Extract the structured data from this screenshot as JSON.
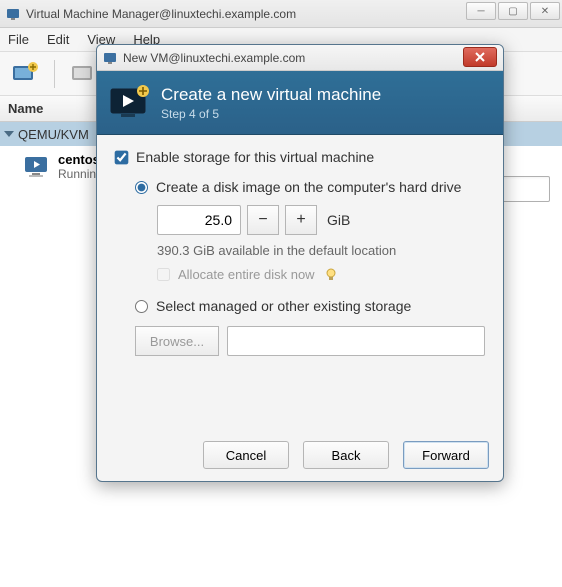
{
  "parent": {
    "title": "Virtual Machine Manager@linuxtechi.example.com",
    "menu": {
      "file": "File",
      "edit": "Edit",
      "view": "View",
      "help": "Help"
    },
    "header": {
      "name": "Name"
    },
    "connection": "QEMU/KVM",
    "vm": {
      "name": "centos",
      "status": "Running"
    }
  },
  "dialog": {
    "title": "New VM@linuxtechi.example.com",
    "hero_title": "Create a new virtual machine",
    "hero_step": "Step 4 of 5",
    "enable_storage": "Enable storage for this virtual machine",
    "create_disk": "Create a disk image on the computer's hard drive",
    "size_value": "25.0",
    "size_unit": "GiB",
    "available": "390.3 GiB available in the default location",
    "allocate_now": "Allocate entire disk now",
    "select_managed": "Select managed or other existing storage",
    "browse": "Browse...",
    "cancel": "Cancel",
    "back": "Back",
    "forward": "Forward"
  }
}
